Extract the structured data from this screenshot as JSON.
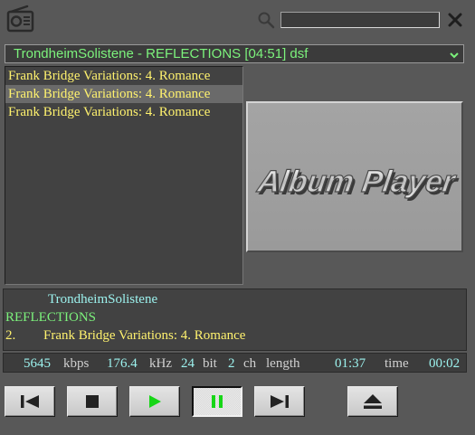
{
  "header": {
    "icons": {
      "radio": "radio-icon",
      "search": "search-icon",
      "close": "close-icon"
    },
    "search": {
      "value": "",
      "placeholder": ""
    }
  },
  "album_select": {
    "selected": "TrondheimSolistene - REFLECTIONS [04:51] dsf",
    "icon": "chevron-down-icon"
  },
  "playlist": {
    "items": [
      {
        "label": "Frank Bridge Variations: 4. Romance"
      },
      {
        "label": "Frank Bridge Variations: 4. Romance"
      },
      {
        "label": "Frank Bridge Variations: 4. Romance"
      }
    ],
    "selected_index": 1
  },
  "album_art": {
    "logo_text": "Album Player"
  },
  "info": {
    "artist": "TrondheimSolistene",
    "album": "REFLECTIONS",
    "track_no": "2.",
    "track_title": "Frank Bridge Variations: 4. Romance"
  },
  "stats": {
    "bitrate": "5645",
    "bitrate_unit": "kbps",
    "samplerate": "176.4",
    "samplerate_unit": "kHz",
    "bits": "24",
    "bits_unit": "bit",
    "channels": "2",
    "channels_unit": "ch",
    "length_label": "length",
    "length": "01:37",
    "time_label": "time",
    "time": "00:02"
  },
  "controls": {
    "buttons": [
      {
        "name": "previous-button",
        "icon": "skip-previous-icon",
        "active": false
      },
      {
        "name": "stop-button",
        "icon": "stop-icon",
        "active": false
      },
      {
        "name": "play-button",
        "icon": "play-icon",
        "active": false
      },
      {
        "name": "pause-button",
        "icon": "pause-icon",
        "active": true
      },
      {
        "name": "next-button",
        "icon": "skip-next-icon",
        "active": false
      },
      {
        "name": "eject-button",
        "icon": "eject-icon",
        "active": false
      }
    ]
  },
  "colors": {
    "background": "#585858",
    "panel": "#424242",
    "green_text": "#7cf27c",
    "yellow_text": "#fff26e",
    "cyan_text": "#9cf2ee",
    "play_green": "#16d616"
  }
}
